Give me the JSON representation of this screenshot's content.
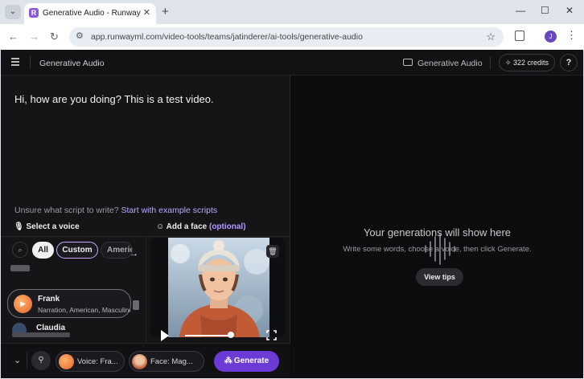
{
  "browser": {
    "tab_title": "Generative Audio - Runway",
    "favicon_letter": "R",
    "url": "app.runwayml.com/video-tools/teams/jatinderer/ai-tools/generative-audio",
    "profile_initial": "J",
    "icons": [
      "chevron-down-icon",
      "close-icon",
      "plus-icon",
      "minimize-icon",
      "maximize-icon",
      "back-icon",
      "forward-icon",
      "reload-icon",
      "tune-icon",
      "star-icon",
      "extension-icon",
      "kebab-icon"
    ]
  },
  "header": {
    "title": "Generative Audio",
    "folder_label": "Generative Audio",
    "credits": "322 credits",
    "help": "?"
  },
  "script": {
    "text": "Hi, how are you doing? This is a test video.",
    "hint_prefix": "Unsure what script to write?",
    "hint_link": "Start with example scripts"
  },
  "voice": {
    "section_label": "Select a voice",
    "filters": [
      "All",
      "Custom",
      "Americ"
    ],
    "selected": {
      "name": "Frank",
      "desc": "Narration, American, Masculine"
    },
    "next": {
      "name": "Claudia"
    }
  },
  "face": {
    "section_label": "Add a face",
    "optional": "(optional)"
  },
  "footer": {
    "voice_pill": "Voice: Fra...",
    "face_pill": "Face: Mag...",
    "generate": "Generate"
  },
  "empty_state": {
    "title": "Your generations will show here",
    "subtitle": "Write some words, choose a voice, then click Generate.",
    "tips": "View tips"
  },
  "colors": {
    "accent": "#6c3bd5",
    "custom_border": "#c8a6ff",
    "link": "#b9a8ff"
  }
}
